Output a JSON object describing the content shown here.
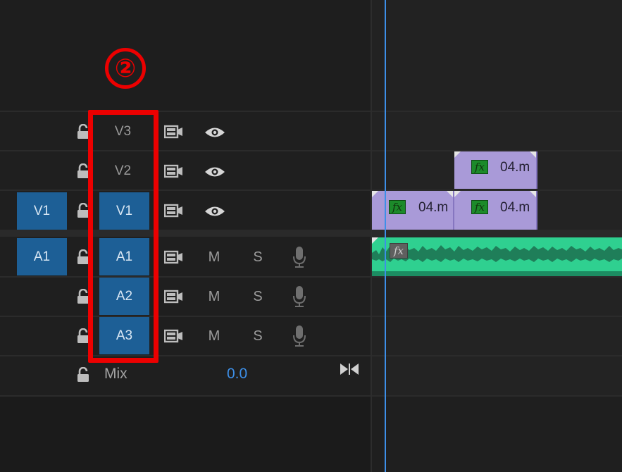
{
  "annotation": {
    "marker": "②"
  },
  "tracks": {
    "video": [
      {
        "source": "",
        "target": "V3",
        "target_active": false
      },
      {
        "source": "",
        "target": "V2",
        "target_active": false
      },
      {
        "source": "V1",
        "target": "V1",
        "target_active": true
      }
    ],
    "audio": [
      {
        "source": "A1",
        "target": "A1",
        "mute": "M",
        "solo": "S"
      },
      {
        "source": "",
        "target": "A2",
        "mute": "M",
        "solo": "S"
      },
      {
        "source": "",
        "target": "A3",
        "mute": "M",
        "solo": "S"
      }
    ]
  },
  "mix": {
    "label": "Mix",
    "value": "0.0"
  },
  "clips": [
    {
      "name": "04.m",
      "fx": "fx",
      "track": "V2"
    },
    {
      "name": "04.m",
      "fx": "fx",
      "track": "V1"
    },
    {
      "name": "04.m",
      "fx": "fx",
      "track": "V1"
    }
  ],
  "audio_clip": {
    "fx": "fx"
  },
  "colors": {
    "target_active": "#1d5f96",
    "highlight": "#ec0000",
    "playhead": "#3d8fe8",
    "video_clip": "#a99ad8",
    "audio_clip": "#2fd090"
  }
}
